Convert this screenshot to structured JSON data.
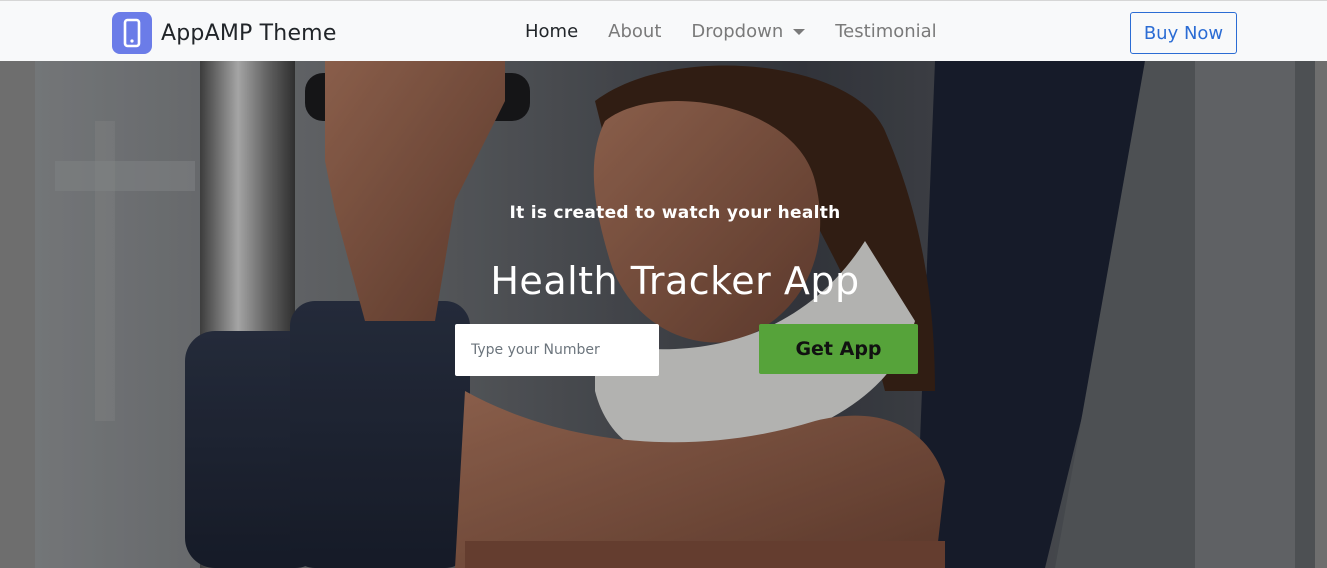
{
  "brand": {
    "name": "AppAMP Theme",
    "logo_icon": "mobile-phone-icon",
    "logo_color": "#6b7ce8"
  },
  "nav": {
    "items": [
      {
        "label": "Home",
        "active": true
      },
      {
        "label": "About",
        "active": false
      },
      {
        "label": "Dropdown",
        "active": false,
        "has_dropdown": true
      },
      {
        "label": "Testimonial",
        "active": false
      }
    ],
    "cta_label": "Buy Now",
    "cta_color": "#2b6cd4"
  },
  "hero": {
    "subtitle": "It is created to watch your health",
    "title": "Health Tracker App",
    "input_placeholder": "Type your Number",
    "button_label": "Get App",
    "button_color": "#56a33a",
    "background": "gym photo of woman on exercise machine"
  }
}
